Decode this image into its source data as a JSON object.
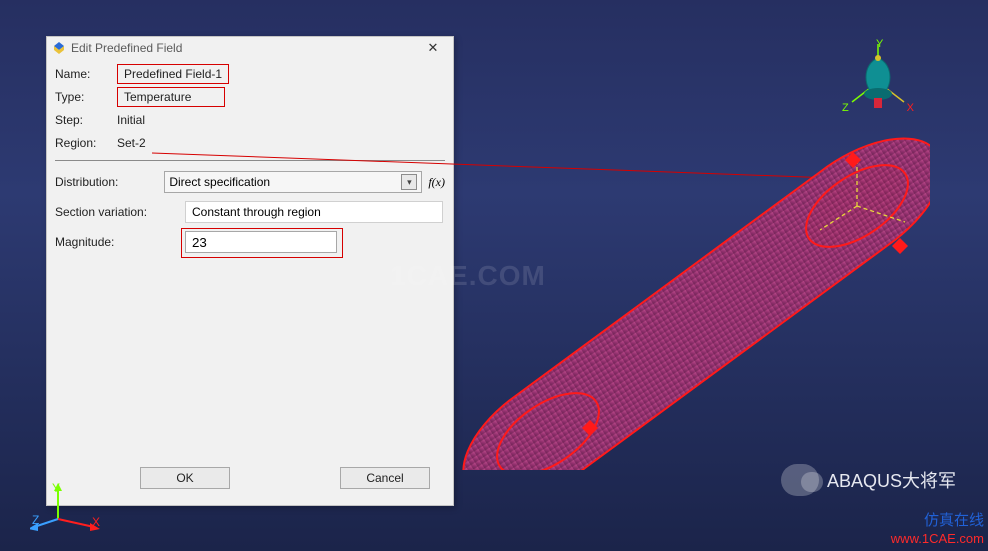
{
  "dialog": {
    "title": "Edit Predefined Field",
    "name_label": "Name:",
    "name_value": "Predefined Field-1",
    "type_label": "Type:",
    "type_value": "Temperature",
    "step_label": "Step:",
    "step_value": "Initial",
    "region_label": "Region:",
    "region_value": "Set-2",
    "dist_label": "Distribution:",
    "dist_value": "Direct specification",
    "secvar_label": "Section variation:",
    "secvar_value": "Constant through region",
    "mag_label": "Magnitude:",
    "mag_value": "23",
    "fx": "f(x)",
    "ok": "OK",
    "cancel": "Cancel",
    "close": "✕"
  },
  "axes": {
    "x": "X",
    "y": "Y",
    "z": "Z"
  },
  "watermark": {
    "center": "1CAE.COM"
  },
  "branding": {
    "channel": "ABAQUS大将军",
    "badge_line1": "仿真在线",
    "badge_line2": "www.1CAE.com"
  },
  "colors": {
    "highlight_red": "#d60000",
    "axis_x": "#FF1E1E",
    "axis_y": "#7BFF00",
    "axis_z": "#3aa0ff",
    "cylinder_fill1": "#b53a7e",
    "cylinder_fill2": "#7e2a64",
    "cylinder_edge": "#ff1a1a"
  }
}
